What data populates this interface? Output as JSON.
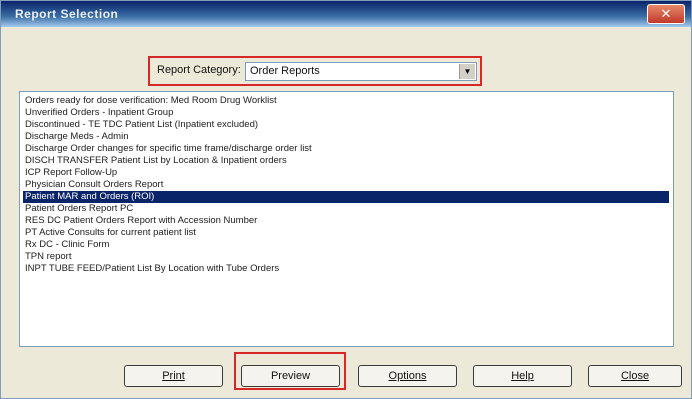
{
  "window": {
    "title": "Report Selection",
    "close_glyph": "✕"
  },
  "filter": {
    "label": "Report Category:",
    "value": "Order Reports",
    "dropdown_glyph": "▼"
  },
  "reports": {
    "items": [
      "Orders ready for dose verification: Med Room Drug Worklist",
      "Unverified Orders - Inpatient Group",
      "Discontinued - TE TDC Patient List (Inpatient excluded)",
      "Discharge Meds - Admin",
      "Discharge Order changes for specific time frame/discharge order list",
      "DISCH TRANSFER Patient List by Location & Inpatient orders",
      "ICP Report Follow-Up",
      "Physician Consult Orders Report",
      "Patient MAR and Orders (ROI)",
      "Patient Orders Report PC",
      "RES DC Patient Orders Report with Accession Number",
      "PT Active Consults for current patient list",
      "Rx DC - Clinic Form",
      "TPN report",
      "INPT TUBE FEED/Patient List By Location with Tube Orders"
    ],
    "selected_index": 8
  },
  "buttons": {
    "print": "Print",
    "preview": "Preview",
    "options": "Options",
    "help": "Help",
    "close": "Close"
  },
  "colors": {
    "highlight_box": "#d62828",
    "selected_row": "#0a246a"
  }
}
